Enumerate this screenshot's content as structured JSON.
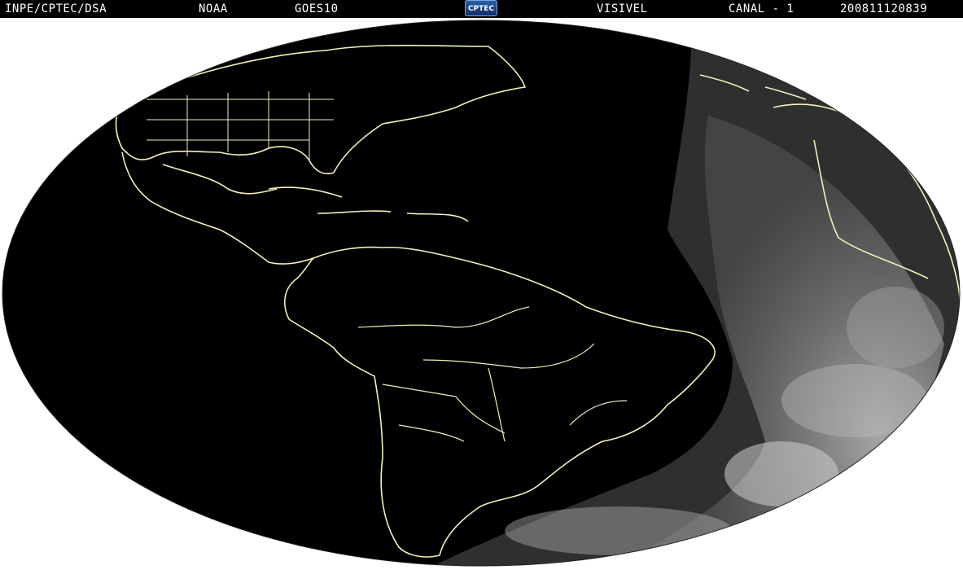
{
  "header": {
    "organization": "INPE/CPTEC/DSA",
    "agency": "NOAA",
    "satellite": "GOES10",
    "band": "VISIVEL",
    "channel": "CANAL - 1",
    "timestamp": "200811120839",
    "logo_text": "CPTEC"
  },
  "map": {
    "background_color": "#ffffff",
    "disk_color": "#000000",
    "outline_color": "#f5f0b8",
    "cloud_color": "#bdbdbd"
  }
}
